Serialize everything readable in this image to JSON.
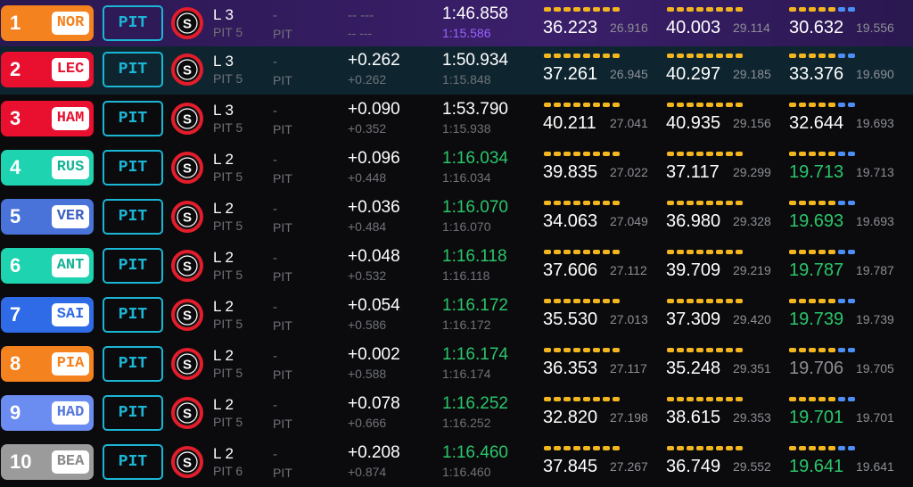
{
  "colors": {
    "pit_border": "#1bb6d6",
    "sector_yellow": "#f3b61f",
    "sector_blue": "#4d8df6",
    "green": "#2ac66b",
    "purple": "#9a63ff"
  },
  "tyre_icon": "soft-tyre-icon",
  "rows": [
    {
      "num": "1",
      "code": "NOR",
      "team_color": "#f4821f",
      "code_color": "#f4821f",
      "pit": "PIT",
      "tyre": "S",
      "lap": "L 3",
      "pit_count": "PIT 5",
      "status": "-",
      "pit_label": "PIT",
      "gap": "-- ---",
      "interval": "-- ---",
      "last": "1:46.858",
      "best": "1:15.586",
      "s1": "36.223",
      "s1_best": "26.916",
      "s2": "40.003",
      "s2_best": "29.114",
      "s3": "30.632",
      "s3_best": "19.556"
    },
    {
      "num": "2",
      "code": "LEC",
      "team_color": "#e8102e",
      "code_color": "#e8102e",
      "pit": "PIT",
      "tyre": "S",
      "lap": "L 3",
      "pit_count": "PIT 5",
      "status": "-",
      "pit_label": "PIT",
      "gap": "+0.262",
      "interval": "+0.262",
      "last": "1:50.934",
      "best": "1:15.848",
      "s1": "37.261",
      "s1_best": "26.945",
      "s2": "40.297",
      "s2_best": "29.185",
      "s3": "33.376",
      "s3_best": "19.690"
    },
    {
      "num": "3",
      "code": "HAM",
      "team_color": "#e8102e",
      "code_color": "#e8102e",
      "pit": "PIT",
      "tyre": "S",
      "lap": "L 3",
      "pit_count": "PIT 5",
      "status": "-",
      "pit_label": "PIT",
      "gap": "+0.090",
      "interval": "+0.352",
      "last": "1:53.790",
      "best": "1:15.938",
      "s1": "40.211",
      "s1_best": "27.041",
      "s2": "40.935",
      "s2_best": "29.156",
      "s3": "32.644",
      "s3_best": "19.693"
    },
    {
      "num": "4",
      "code": "RUS",
      "team_color": "#1ed3b0",
      "code_color": "#15b496",
      "pit": "PIT",
      "tyre": "S",
      "lap": "L 2",
      "pit_count": "PIT 5",
      "status": "-",
      "pit_label": "PIT",
      "gap": "+0.096",
      "interval": "+0.448",
      "last": "1:16.034",
      "best": "1:16.034",
      "s1": "39.835",
      "s1_best": "27.022",
      "s2": "37.117",
      "s2_best": "29.299",
      "s3": "19.713",
      "s3_best": "19.713"
    },
    {
      "num": "5",
      "code": "VER",
      "team_color": "#4a73d9",
      "code_color": "#3b5fc4",
      "pit": "PIT",
      "tyre": "S",
      "lap": "L 2",
      "pit_count": "PIT 5",
      "status": "-",
      "pit_label": "PIT",
      "gap": "+0.036",
      "interval": "+0.484",
      "last": "1:16.070",
      "best": "1:16.070",
      "s1": "34.063",
      "s1_best": "27.049",
      "s2": "36.980",
      "s2_best": "29.328",
      "s3": "19.693",
      "s3_best": "19.693"
    },
    {
      "num": "6",
      "code": "ANT",
      "team_color": "#1ed3b0",
      "code_color": "#15b496",
      "pit": "PIT",
      "tyre": "S",
      "lap": "L 2",
      "pit_count": "PIT 5",
      "status": "-",
      "pit_label": "PIT",
      "gap": "+0.048",
      "interval": "+0.532",
      "last": "1:16.118",
      "best": "1:16.118",
      "s1": "37.606",
      "s1_best": "27.112",
      "s2": "39.709",
      "s2_best": "29.219",
      "s3": "19.787",
      "s3_best": "19.787"
    },
    {
      "num": "7",
      "code": "SAI",
      "team_color": "#2f6be6",
      "code_color": "#2f6be6",
      "pit": "PIT",
      "tyre": "S",
      "lap": "L 2",
      "pit_count": "PIT 5",
      "status": "-",
      "pit_label": "PIT",
      "gap": "+0.054",
      "interval": "+0.586",
      "last": "1:16.172",
      "best": "1:16.172",
      "s1": "35.530",
      "s1_best": "27.013",
      "s2": "37.309",
      "s2_best": "29.420",
      "s3": "19.739",
      "s3_best": "19.739"
    },
    {
      "num": "8",
      "code": "PIA",
      "team_color": "#f4821f",
      "code_color": "#f4821f",
      "pit": "PIT",
      "tyre": "S",
      "lap": "L 2",
      "pit_count": "PIT 5",
      "status": "-",
      "pit_label": "PIT",
      "gap": "+0.002",
      "interval": "+0.588",
      "last": "1:16.174",
      "best": "1:16.174",
      "s1": "36.353",
      "s1_best": "27.117",
      "s2": "35.248",
      "s2_best": "29.351",
      "s3": "19.706",
      "s3_best": "19.705"
    },
    {
      "num": "9",
      "code": "HAD",
      "team_color": "#6b8cf0",
      "code_color": "#5577e0",
      "pit": "PIT",
      "tyre": "S",
      "lap": "L 2",
      "pit_count": "PIT 5",
      "status": "-",
      "pit_label": "PIT",
      "gap": "+0.078",
      "interval": "+0.666",
      "last": "1:16.252",
      "best": "1:16.252",
      "s1": "32.820",
      "s1_best": "27.198",
      "s2": "38.615",
      "s2_best": "29.353",
      "s3": "19.701",
      "s3_best": "19.701"
    },
    {
      "num": "10",
      "code": "BEA",
      "team_color": "#9b9b9b",
      "code_color": "#8a8a8a",
      "pit": "PIT",
      "tyre": "S",
      "lap": "L 2",
      "pit_count": "PIT 6",
      "status": "-",
      "pit_label": "PIT",
      "gap": "+0.208",
      "interval": "+0.874",
      "last": "1:16.460",
      "best": "1:16.460",
      "s1": "37.845",
      "s1_best": "27.267",
      "s2": "36.749",
      "s2_best": "29.552",
      "s3": "19.641",
      "s3_best": "19.641"
    }
  ]
}
